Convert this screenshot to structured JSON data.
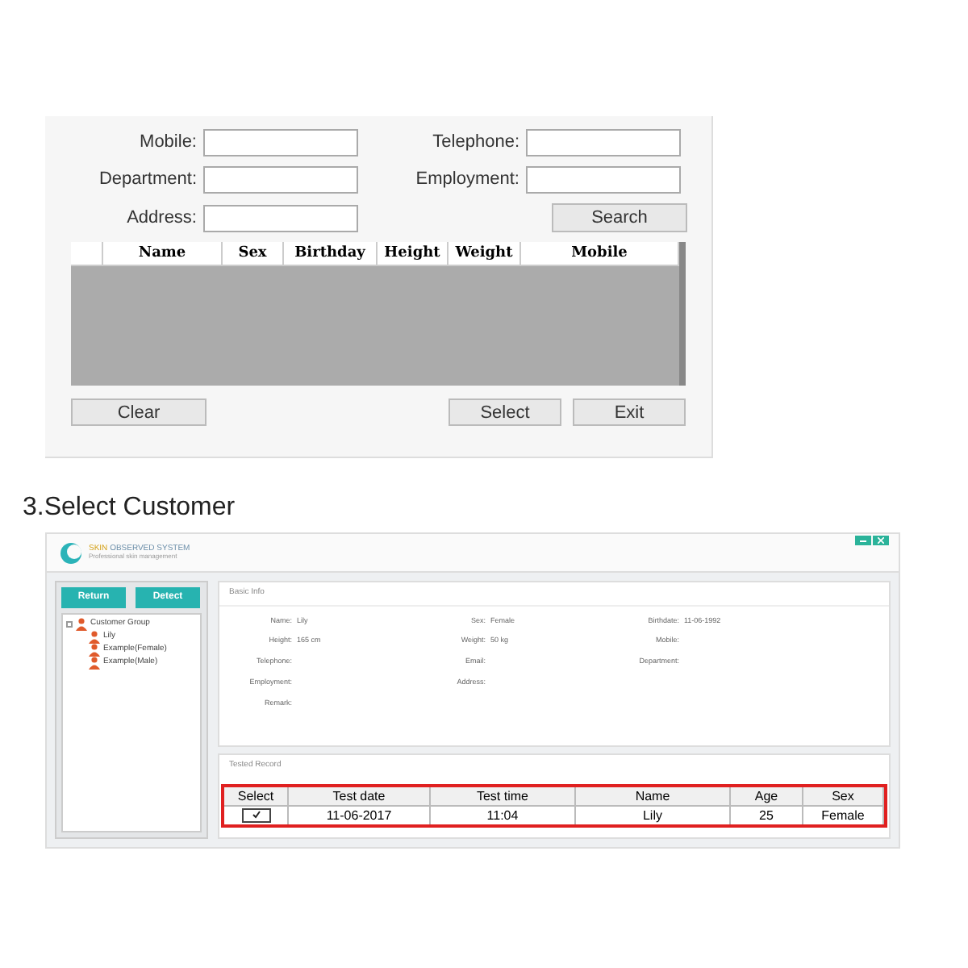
{
  "search_dialog": {
    "fields": [
      {
        "label": "Mobile:"
      },
      {
        "label": "Telephone:"
      },
      {
        "label": "Department:"
      },
      {
        "label": "Employment:"
      },
      {
        "label": "Address:"
      }
    ],
    "search_button": "Search",
    "table": {
      "columns": [
        "Name",
        "Sex",
        "Birthday",
        "Height",
        "Weight",
        "Mobile"
      ]
    },
    "buttons": {
      "left": "Clear",
      "right": [
        "Select",
        "Exit"
      ]
    }
  },
  "heading": "3.Select Customer",
  "app": {
    "brand": {
      "name_accent": "SKIN",
      "name": "OBSERVED SYSTEM",
      "tagline": "Professional skin management"
    },
    "toolbar": [
      "Return",
      "Detect"
    ],
    "tree": {
      "label": "Customer Group",
      "expanded": true,
      "children": [
        {
          "label": "Lily"
        },
        {
          "label": "Example(Female)"
        },
        {
          "label": "Example(Male)"
        }
      ]
    },
    "basic_info": {
      "title": "Basic Info",
      "rows": [
        [
          {
            "label": "Name:",
            "value": "Lily"
          },
          {
            "label": "Sex:",
            "value": "Female"
          },
          {
            "label": "Birthdate:",
            "value": "11-06-1992"
          }
        ],
        [
          {
            "label": "Height:",
            "value": "165 cm"
          },
          {
            "label": "Weight:",
            "value": "50 kg"
          },
          {
            "label": "Mobile:"
          }
        ],
        [
          {
            "label": "Telephone:"
          },
          {
            "label": "Email:"
          },
          {
            "label": "Department:"
          }
        ],
        [
          {
            "label": "Employment:"
          },
          {
            "label": "Address:"
          }
        ],
        [
          {
            "label": "Remark:"
          }
        ]
      ]
    },
    "tested_record": {
      "title": "Tested Record",
      "columns": [
        "Select",
        "Test date",
        "Test time",
        "Name",
        "Age",
        "Sex"
      ],
      "rows": [
        {
          "select": {
            "checked": true
          },
          "test_date": "11-06-2017",
          "test_time": "11:04",
          "name": "Lily",
          "age": "25",
          "sex": "Female"
        }
      ]
    }
  }
}
